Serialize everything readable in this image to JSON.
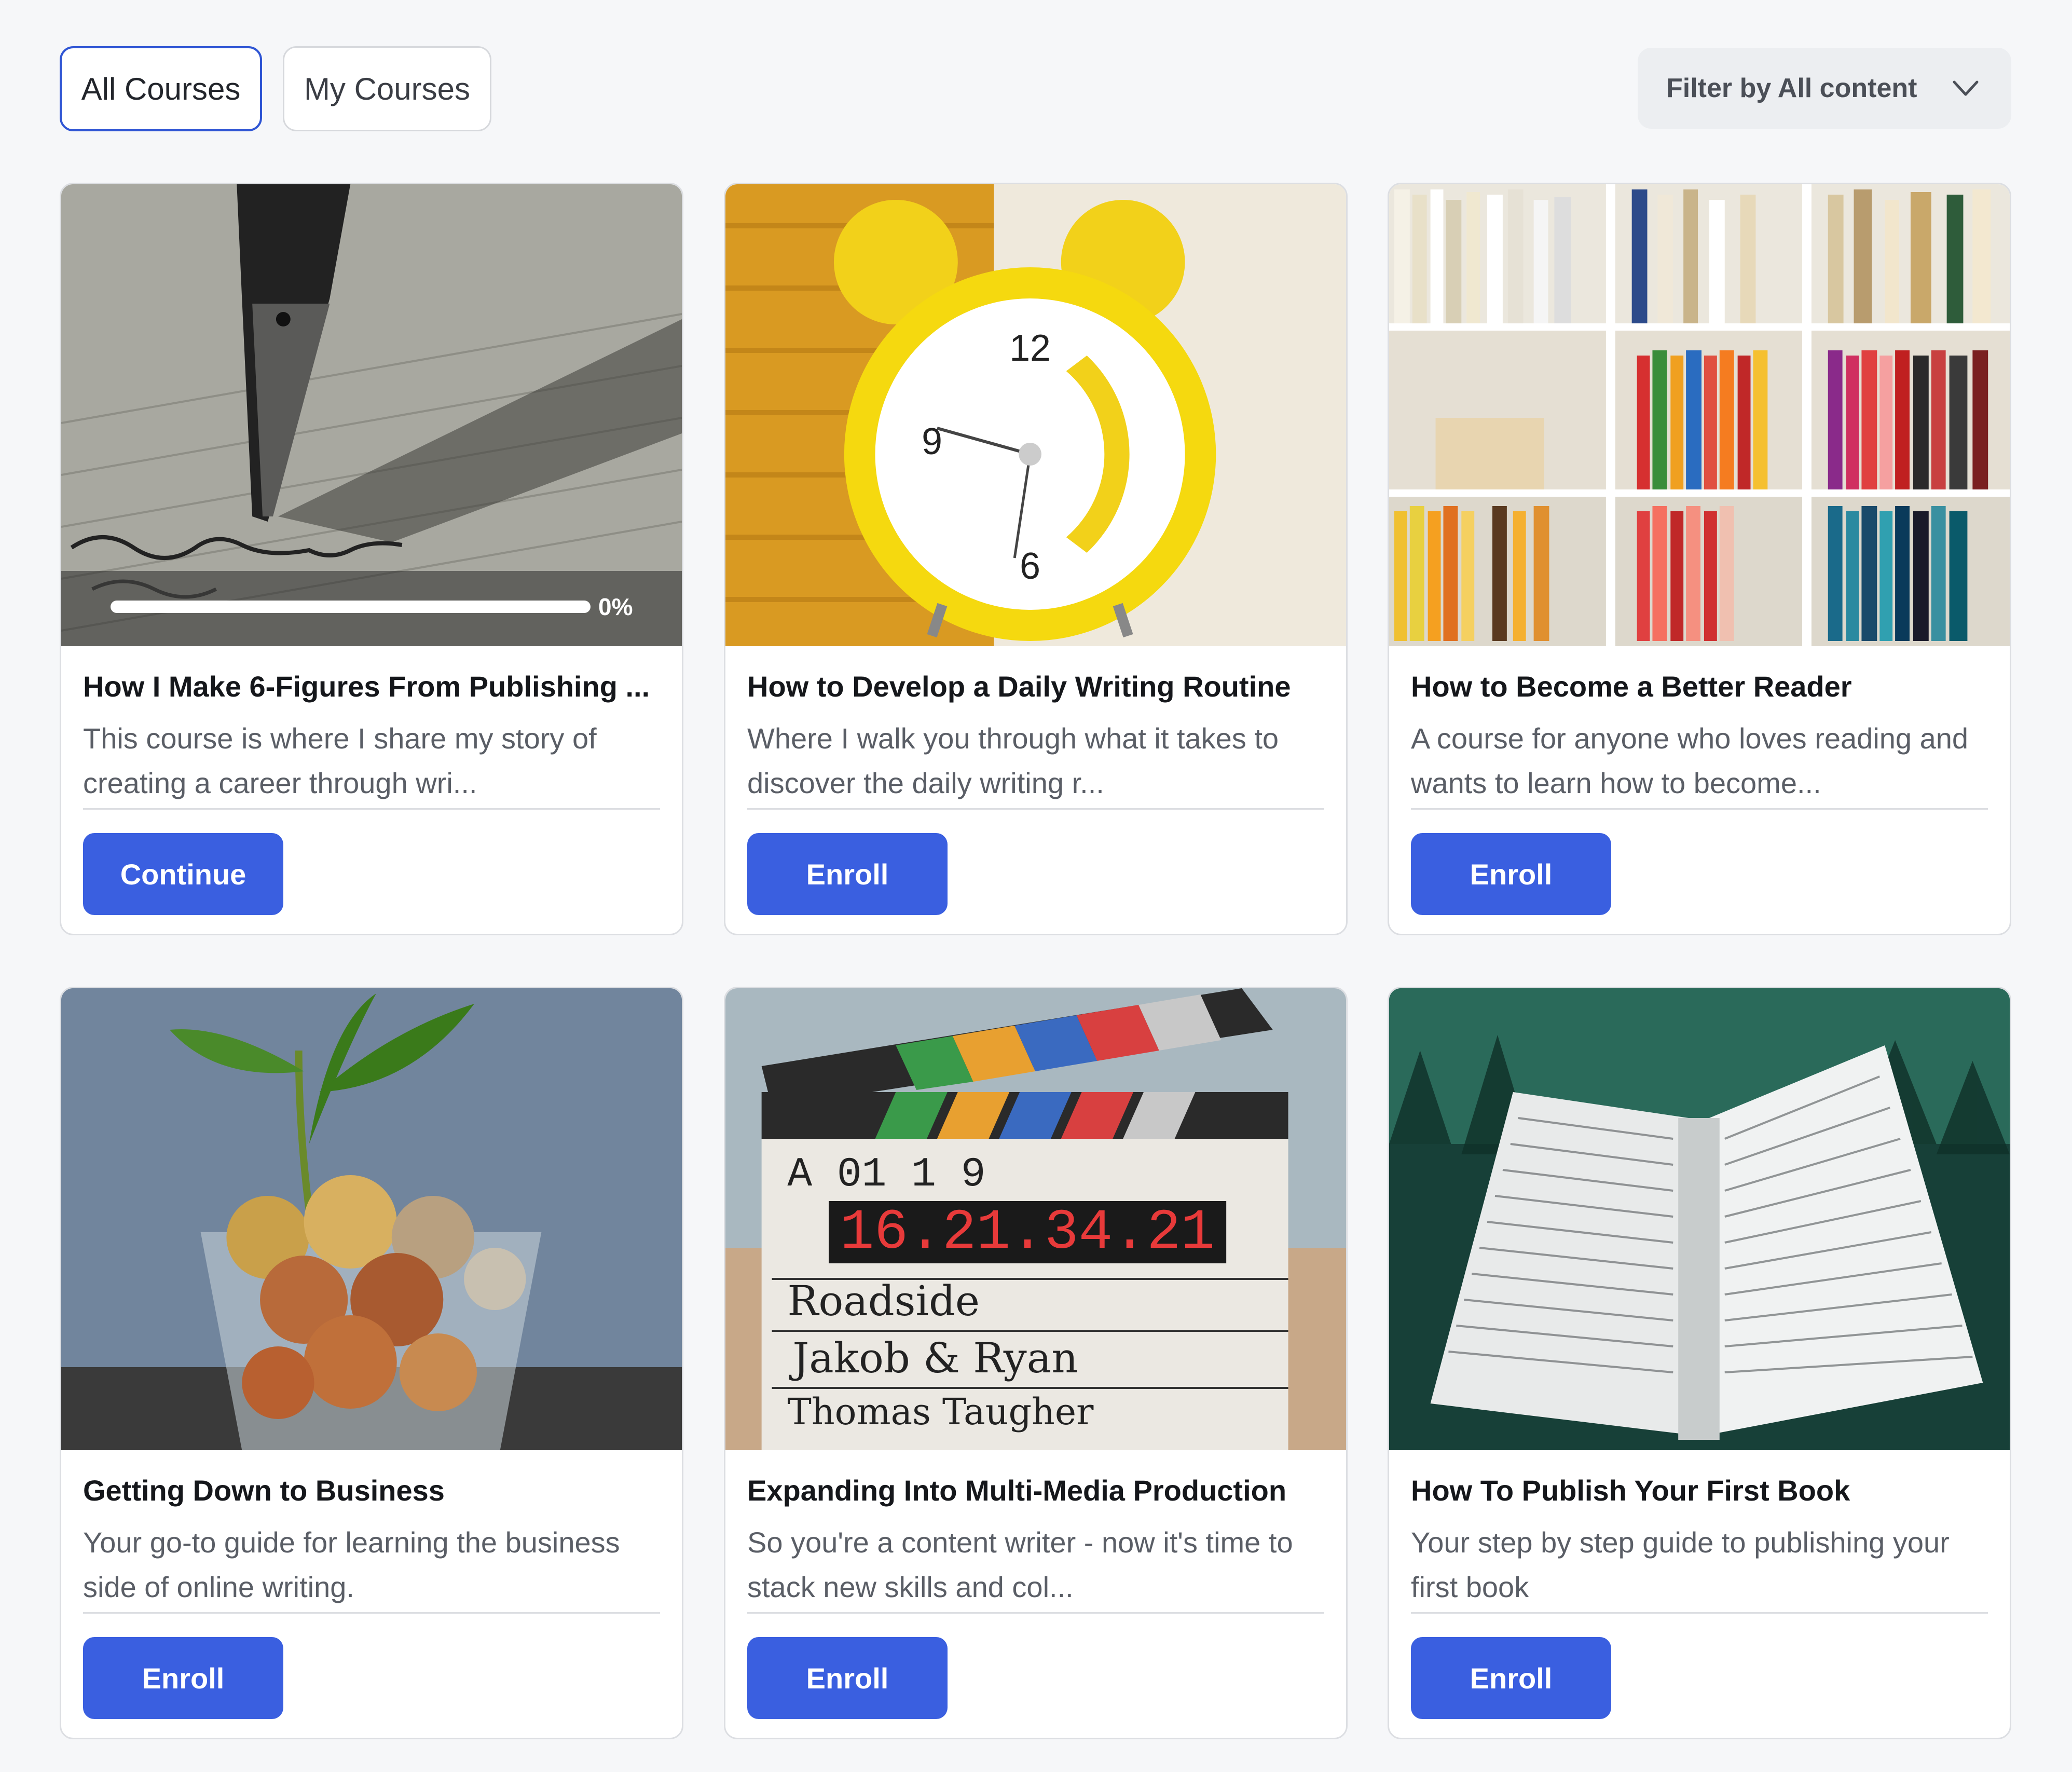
{
  "tabs": [
    {
      "label": "All Courses",
      "active": true
    },
    {
      "label": "My Courses",
      "active": false
    }
  ],
  "filter": {
    "label": "Filter by All content",
    "icon": "chevron-down-icon"
  },
  "colors": {
    "accent": "#3a5fe0",
    "background": "#f6f7f9"
  },
  "courses": [
    {
      "title": "How I Make 6-Figures From Publishing ...",
      "description": "This course is where I share my story of creating a career through wri...",
      "button": "Continue",
      "progress_percent": 0,
      "progress_label": "0%",
      "image": "fountain-pen-writing-image"
    },
    {
      "title": "How to Develop a Daily Writing Routine",
      "description": "Where I walk you through what it takes to discover the daily writing r...",
      "button": "Enroll",
      "image": "yellow-alarm-clock-image"
    },
    {
      "title": "How to Become a Better Reader",
      "description": "A course for anyone who loves reading and wants to learn how to become...",
      "button": "Enroll",
      "image": "bookshelf-image"
    },
    {
      "title": "Getting Down to Business",
      "description": "Your go-to guide for learning the business side of online writing.",
      "button": "Enroll",
      "image": "coins-in-jar-plant-image"
    },
    {
      "title": "Expanding Into Multi-Media Production",
      "description": "So you're a content writer - now it's time to stack new skills and col...",
      "button": "Enroll",
      "image": "film-clapperboard-image"
    },
    {
      "title": "How To Publish Your First Book",
      "description": "Your step by step guide to publishing your first book",
      "button": "Enroll",
      "image": "open-book-forest-image"
    }
  ]
}
